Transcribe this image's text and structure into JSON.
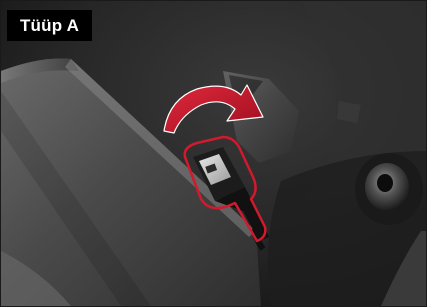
{
  "figure": {
    "label": "Tüüp A",
    "colors": {
      "label_background": "#000000",
      "label_text": "#ffffff",
      "arrow": "#d01a2e",
      "outline": "#d01a2e",
      "carpet": "#2a2a2a",
      "trim_panel": "#5a5a5a"
    },
    "icons": [
      "curved-arrow-icon"
    ]
  }
}
